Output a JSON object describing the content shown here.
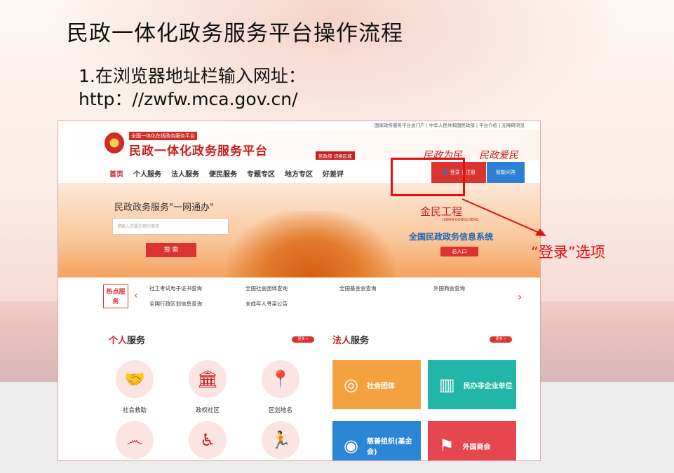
{
  "slide": {
    "title": "民政一体化政务服务平台操作流程",
    "step": "1.在浏览器地址栏输入网址：http：//zwfw.mca.gov.cn/",
    "annotation": "“登录”选项"
  },
  "screenshot": {
    "topbar": "国家政务服务平台总门户 | 中华人民共和国民政部 | 平台介绍 | 无障碍浏览",
    "logo_small": "全国一体化在线政务服务平台",
    "logo_big": "民政一体化政务服务平台",
    "region": "民政部 切换区域",
    "slogan1": "民政为民",
    "slogan2": "民政爱民",
    "nav": [
      "首页",
      "个人服务",
      "法人服务",
      "便民服务",
      "专题专区",
      "地方专区",
      "好差评"
    ],
    "login": "登录",
    "register": "注册",
    "smart_qa": "智能问答",
    "hero_title": "民政政务服务\"一网通办\"",
    "search_placeholder": "请输入您要办理的事项",
    "search_button": "搜 索",
    "jm_logo": "金民工程",
    "jm_sub": "JINMIN GONGCHENG",
    "jm_title": "全国民政政务信息系统",
    "jm_button": "总入口",
    "hot_badge": "热点服务",
    "hot_links": [
      "社工考试电子证书查询",
      "全国社会团体查询",
      "全国基金会查询",
      "外国商会查询",
      "全国行政区划信息查询",
      "未成年人寻亲公告"
    ],
    "personal_prefix": "个人",
    "personal_suffix": "服务",
    "legal_prefix": "法人",
    "legal_suffix": "服务",
    "more": "更多 »",
    "personal_items": [
      "社会救助",
      "政权社区",
      "区划地名"
    ],
    "legal_cards": [
      "社会团体",
      "民办非企业单位",
      "慈善组织(基金会)",
      "外国商会"
    ],
    "colors": {
      "brand_red": "#c71f1f",
      "blue": "#2d7fd6",
      "orange": "#f6a25f"
    }
  }
}
